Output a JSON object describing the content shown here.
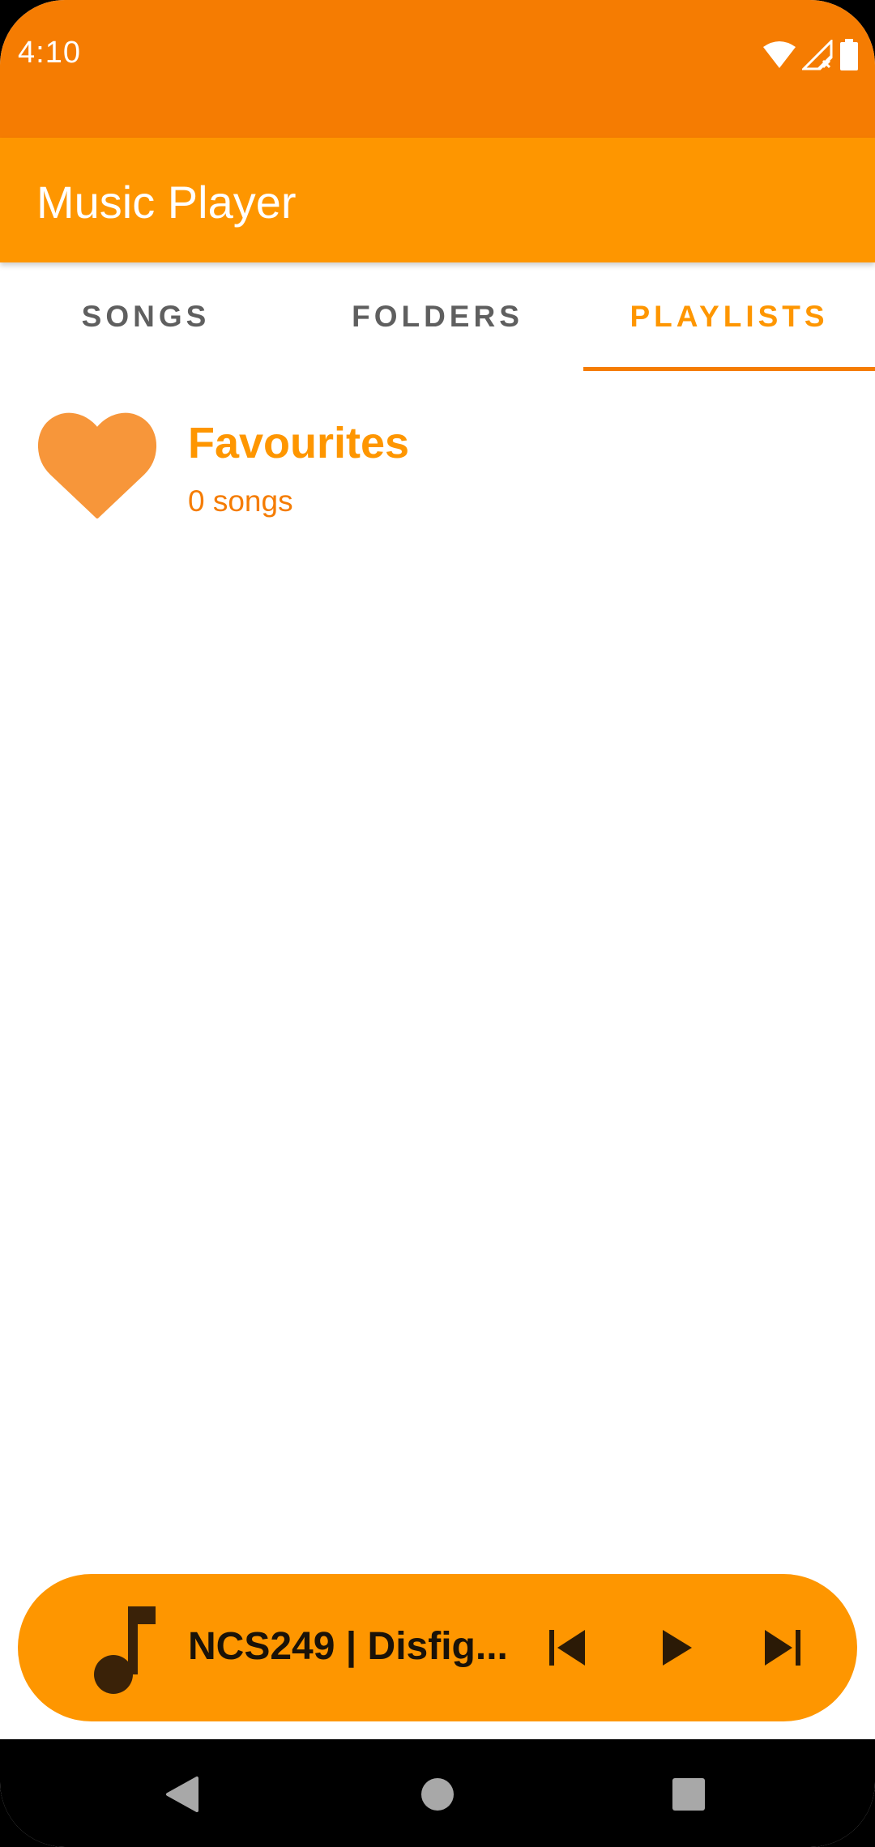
{
  "status_bar": {
    "time": "4:10",
    "icons": [
      "wifi-icon",
      "signal-icon",
      "battery-icon"
    ]
  },
  "app_bar": {
    "title": "Music Player"
  },
  "tabs": [
    {
      "label": "SONGS",
      "active": false
    },
    {
      "label": "FOLDERS",
      "active": false
    },
    {
      "label": "PLAYLISTS",
      "active": true
    }
  ],
  "playlists": [
    {
      "icon": "heart-icon",
      "name": "Favourites",
      "count": "0 songs"
    }
  ],
  "mini_player": {
    "icon": "music-note-icon",
    "track_title": "NCS249 | Disfig...",
    "controls": [
      "skip-previous-icon",
      "play-icon",
      "skip-next-icon"
    ]
  },
  "nav_bar": {
    "buttons": [
      "back-icon",
      "home-icon",
      "recents-icon"
    ]
  },
  "colors": {
    "status_bar": "#f57c02",
    "app_bar": "#fe9600",
    "accent": "#fe9600",
    "heart": "#f7963a",
    "tab_inactive": "#5f5f5f",
    "mini_player_fg": "#1a1208"
  }
}
